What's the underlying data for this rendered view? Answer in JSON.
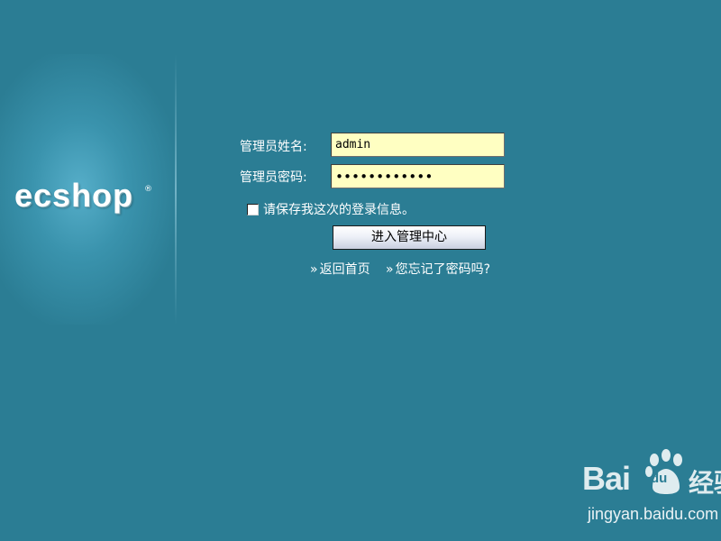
{
  "brand": {
    "logo_text": "ecshop",
    "reg_mark": "®"
  },
  "login_form": {
    "username_label": "管理员姓名:",
    "username_value": "admin",
    "password_label": "管理员密码:",
    "password_value": "••••••••••••",
    "remember_label": "请保存我这次的登录信息。",
    "remember_checked": false,
    "submit_label": "进入管理中心"
  },
  "links": {
    "arrow": "»",
    "home_label": "返回首页",
    "forgot_label": "您忘记了密码吗?"
  },
  "watermark": {
    "brand_text": "Bai",
    "brand_du": "du",
    "product_text": "经验",
    "url": "jingyan.baidu.com"
  },
  "colors": {
    "background": "#2b7d94",
    "input_background": "#ffffc2",
    "text": "#ffffff"
  }
}
